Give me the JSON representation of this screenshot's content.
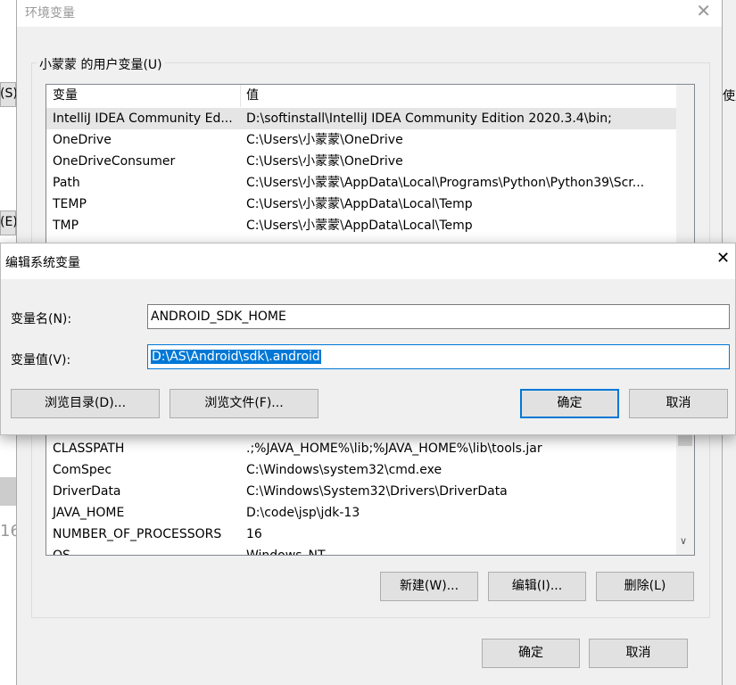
{
  "background_fragments": {
    "left1": "(S).",
    "left2": "(E).",
    "left3": "16",
    "right1": "使用"
  },
  "env_dialog": {
    "title": "环境变量",
    "user_group_label": "小蒙蒙 的用户变量(U)",
    "columns": [
      "变量",
      "值"
    ],
    "user_vars": [
      {
        "name": "IntelliJ IDEA Community Ed...",
        "value": "D:\\softinstall\\IntelliJ IDEA Community Edition 2020.3.4\\bin;"
      },
      {
        "name": "OneDrive",
        "value": "C:\\Users\\小蒙蒙\\OneDrive"
      },
      {
        "name": "OneDriveConsumer",
        "value": "C:\\Users\\小蒙蒙\\OneDrive"
      },
      {
        "name": "Path",
        "value": "C:\\Users\\小蒙蒙\\AppData\\Local\\Programs\\Python\\Python39\\Scr..."
      },
      {
        "name": "TEMP",
        "value": "C:\\Users\\小蒙蒙\\AppData\\Local\\Temp"
      },
      {
        "name": "TMP",
        "value": "C:\\Users\\小蒙蒙\\AppData\\Local\\Temp"
      }
    ],
    "system_vars": [
      {
        "name": "CLASSPATH",
        "value": ".;%JAVA_HOME%\\lib;%JAVA_HOME%\\lib\\tools.jar"
      },
      {
        "name": "ComSpec",
        "value": "C:\\Windows\\system32\\cmd.exe"
      },
      {
        "name": "DriverData",
        "value": "C:\\Windows\\System32\\Drivers\\DriverData"
      },
      {
        "name": "JAVA_HOME",
        "value": "D:\\code\\jsp\\jdk-13"
      },
      {
        "name": "NUMBER_OF_PROCESSORS",
        "value": "16"
      },
      {
        "name": "OS",
        "value": "Windows_NT"
      }
    ],
    "new_button": "新建(W)...",
    "edit_button": "编辑(I)...",
    "delete_button": "删除(L)",
    "ok_button": "确定",
    "cancel_button": "取消"
  },
  "edit_dialog": {
    "title": "编辑系统变量",
    "name_label": "变量名(N):",
    "name_value": "ANDROID_SDK_HOME",
    "value_label": "变量值(V):",
    "value_value": "D:\\AS\\Android\\sdk\\.android",
    "browse_dir_button": "浏览目录(D)...",
    "browse_file_button": "浏览文件(F)...",
    "ok_button": "确定",
    "cancel_button": "取消"
  },
  "colors": {
    "accent": "#0078d7"
  }
}
